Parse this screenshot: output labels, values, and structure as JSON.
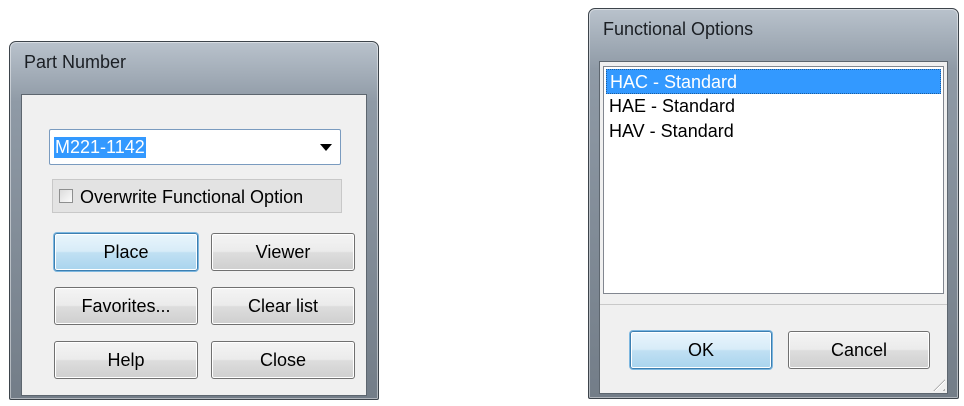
{
  "part_number_dialog": {
    "title": "Part Number",
    "combo_value": "M221-1142",
    "checkbox_label": "Overwrite Functional Option",
    "checkbox_checked": false,
    "buttons": {
      "place": "Place",
      "viewer": "Viewer",
      "favorites": "Favorites...",
      "clear_list": "Clear list",
      "help": "Help",
      "close": "Close"
    }
  },
  "functional_options_dialog": {
    "title": "Functional Options",
    "items": [
      {
        "label": "HAC - Standard",
        "selected": true
      },
      {
        "label": "HAE - Standard",
        "selected": false
      },
      {
        "label": "HAV - Standard",
        "selected": false
      }
    ],
    "buttons": {
      "ok": "OK",
      "cancel": "Cancel"
    }
  },
  "colors": {
    "selection": "#3399ff",
    "default_button": "#c0e0f3",
    "window_frame": "#8f9aa6"
  }
}
